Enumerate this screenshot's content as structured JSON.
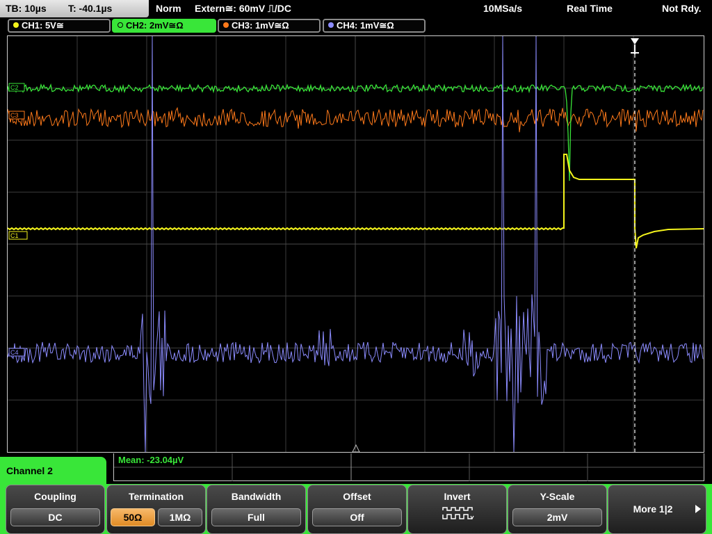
{
  "topbar": {
    "timebase": "TB: 10µs",
    "trigger_time": "T: -40.1µs",
    "trigger_mode": "Norm",
    "trigger_source": "Extern≅: 60mV ⎍/DC",
    "sample_rate": "10MSa/s",
    "acq_mode": "Real Time",
    "status": "Not Rdy."
  },
  "channels": [
    {
      "label": "CH1: 5V≅",
      "color": "#f4f41c"
    },
    {
      "label": "CH2: 2mV≅Ω",
      "color": "#39e639"
    },
    {
      "label": "CH3: 1mV≅Ω",
      "color": "#ff7a1a"
    },
    {
      "label": "CH4: 1mV≅Ω",
      "color": "#8c8cff"
    }
  ],
  "markers": {
    "ch1": "C1",
    "ch2": "C2",
    "ch3": "C3",
    "ch4": "C4"
  },
  "measurement": {
    "mean": "Mean: -23.04µV"
  },
  "menu": {
    "title": "Channel 2",
    "coupling": {
      "label": "Coupling",
      "value": "DC"
    },
    "termination": {
      "label": "Termination",
      "opt1": "50Ω",
      "opt2": "1MΩ",
      "selected": "50Ω"
    },
    "bandwidth": {
      "label": "Bandwidth",
      "value": "Full"
    },
    "offset": {
      "label": "Offset",
      "value": "Off"
    },
    "invert": {
      "label": "Invert"
    },
    "yscale": {
      "label": "Y-Scale",
      "value": "2mV"
    },
    "more": {
      "label": "More 1|2"
    }
  },
  "colors": {
    "accent": "#39e639",
    "grid": "#3c3c3c",
    "ch1": "#f4f41c",
    "ch2": "#39e639",
    "ch3": "#ff7a1a",
    "ch4": "#8c8cff"
  }
}
